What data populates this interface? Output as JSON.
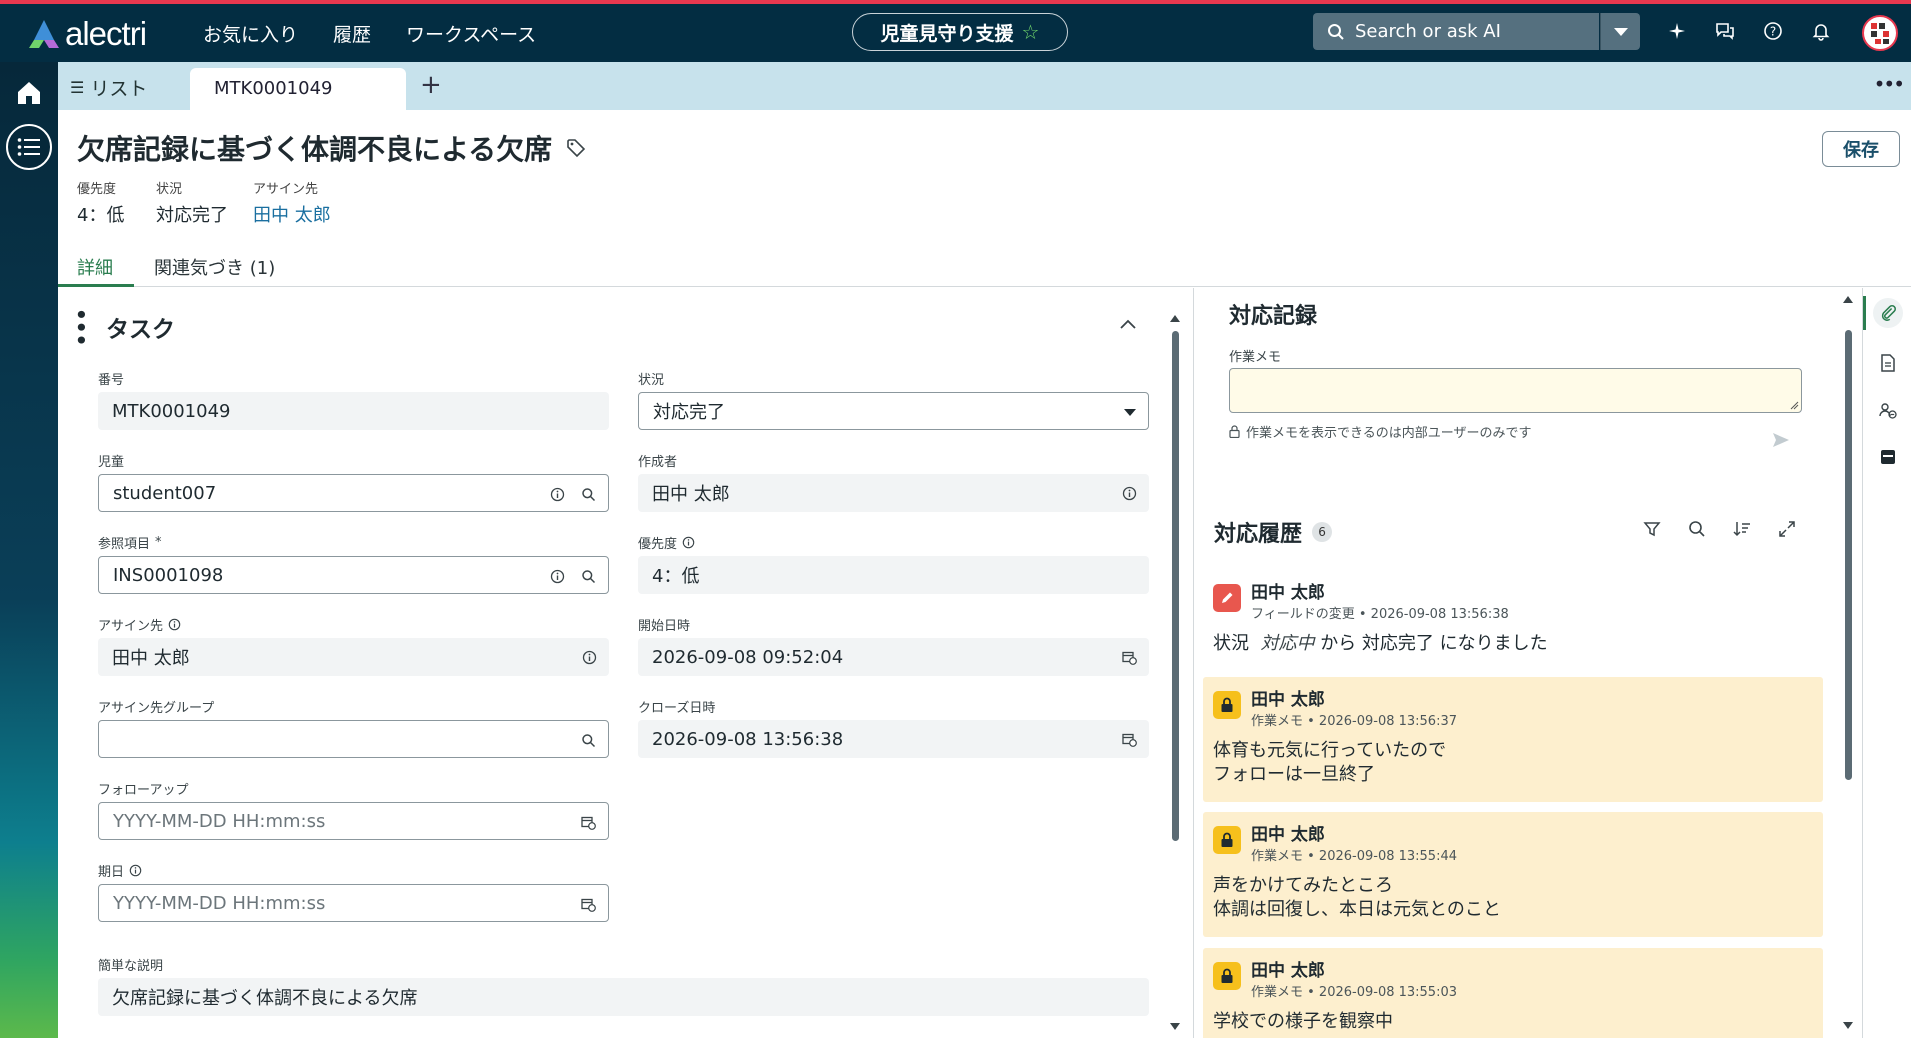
{
  "app": {
    "logo_text": "alectri",
    "brand_colors": {
      "header": "#032d42",
      "accent_red": "#e8384f",
      "accent_green": "#2a7d4f"
    }
  },
  "topnav": {
    "items": [
      "お気に入り",
      "履歴",
      "ワークスペース"
    ]
  },
  "workspace": {
    "label": "児童見守り支援",
    "star_icon": "star-outline-icon"
  },
  "search": {
    "placeholder": "Search or ask AI"
  },
  "tabs": {
    "list_label": "リスト",
    "active_tab": "MTK0001049"
  },
  "record": {
    "title": "欠席記録に基づく体調不良による欠席",
    "save_label": "保存",
    "meta": [
      {
        "label": "優先度",
        "value": "4：低"
      },
      {
        "label": "状況",
        "value": "対応完了"
      },
      {
        "label": "アサイン先",
        "value": "田中 太郎"
      }
    ]
  },
  "subtabs": {
    "details": "詳細",
    "related": "関連気づき (1)"
  },
  "section": {
    "title": "タスク"
  },
  "fields": {
    "number": {
      "label": "番号",
      "value": "MTK0001049"
    },
    "status": {
      "label": "状況",
      "value": "対応完了"
    },
    "student": {
      "label": "児童",
      "value": "student007"
    },
    "creator": {
      "label": "作成者",
      "value": "田中 太郎"
    },
    "reference": {
      "label": "参照項目",
      "required": "*",
      "value": "INS0001098"
    },
    "priority": {
      "label": "優先度",
      "value": "4：低"
    },
    "assignee": {
      "label": "アサイン先",
      "value": "田中 太郎"
    },
    "start": {
      "label": "開始日時",
      "value": "2026-09-08 09:52:04"
    },
    "assign_group": {
      "label": "アサイン先グループ",
      "value": ""
    },
    "close": {
      "label": "クローズ日時",
      "value": "2026-09-08 13:56:38"
    },
    "followup": {
      "label": "フォローアップ",
      "placeholder": "YYYY-MM-DD HH:mm:ss"
    },
    "due": {
      "label": "期日",
      "placeholder": "YYYY-MM-DD HH:mm:ss"
    },
    "short_desc": {
      "label": "簡単な説明",
      "value": "欠席記録に基づく体調不良による欠席"
    }
  },
  "activity": {
    "title": "対応記録",
    "memo_label": "作業メモ",
    "memo_note": "作業メモを表示できるのは内部ユーザーのみです",
    "history_title": "対応履歴",
    "history_count": "6",
    "entries": [
      {
        "name": "田中 太郎",
        "sub": "フィールドの変更 • 2026-09-08 13:56:38",
        "field": "状況",
        "old": "対応中",
        "from": "から",
        "new": "対応完了",
        "suffix": "になりました"
      },
      {
        "name": "田中 太郎",
        "sub": "作業メモ • 2026-09-08 13:56:37",
        "body": "体育も元気に行っていたので\nフォローは一旦終了"
      },
      {
        "name": "田中 太郎",
        "sub": "作業メモ • 2026-09-08 13:55:44",
        "body": "声をかけてみたところ\n体調は回復し、本日は元気とのこと"
      },
      {
        "name": "田中 太郎",
        "sub": "作業メモ • 2026-09-08 13:55:03",
        "body": "学校での様子を観察中"
      }
    ]
  }
}
